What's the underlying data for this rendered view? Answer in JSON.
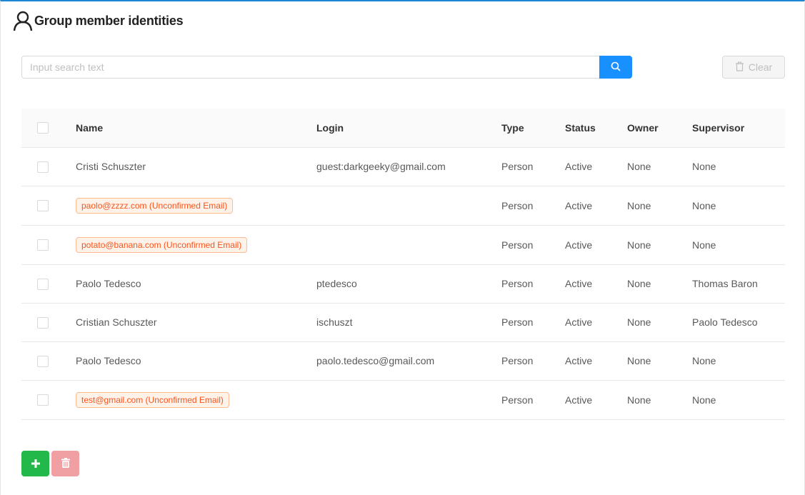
{
  "header": {
    "title": "Group member identities",
    "icon": "user-icon"
  },
  "search": {
    "placeholder": "Input search text",
    "value": "",
    "button_icon": "search-icon"
  },
  "toolbar": {
    "clear_label": "Clear",
    "clear_icon": "trash-icon"
  },
  "table": {
    "columns": [
      "Name",
      "Login",
      "Type",
      "Status",
      "Owner",
      "Supervisor"
    ],
    "rows": [
      {
        "name": "Cristi Schuszter",
        "unconfirmed": false,
        "login": "guest:darkgeeky@gmail.com",
        "type": "Person",
        "status": "Active",
        "owner": "None",
        "supervisor": "None"
      },
      {
        "name": "paolo@zzzz.com (Unconfirmed Email)",
        "unconfirmed": true,
        "login": "",
        "type": "Person",
        "status": "Active",
        "owner": "None",
        "supervisor": "None"
      },
      {
        "name": "potato@banana.com (Unconfirmed Email)",
        "unconfirmed": true,
        "login": "",
        "type": "Person",
        "status": "Active",
        "owner": "None",
        "supervisor": "None"
      },
      {
        "name": "Paolo Tedesco",
        "unconfirmed": false,
        "login": "ptedesco",
        "type": "Person",
        "status": "Active",
        "owner": "None",
        "supervisor": "Thomas Baron"
      },
      {
        "name": "Cristian Schuszter",
        "unconfirmed": false,
        "login": "ischuszt",
        "type": "Person",
        "status": "Active",
        "owner": "None",
        "supervisor": "Paolo Tedesco"
      },
      {
        "name": "Paolo Tedesco",
        "unconfirmed": false,
        "login": "paolo.tedesco@gmail.com",
        "type": "Person",
        "status": "Active",
        "owner": "None",
        "supervisor": "None"
      },
      {
        "name": "test@gmail.com (Unconfirmed Email)",
        "unconfirmed": true,
        "login": "",
        "type": "Person",
        "status": "Active",
        "owner": "None",
        "supervisor": "None"
      }
    ]
  },
  "actions": {
    "add_icon": "plus-icon",
    "delete_icon": "trash-icon"
  },
  "colors": {
    "accent": "#1890ff",
    "top_border": "#1f86d6",
    "add": "#22b94a",
    "delete_disabled": "#f0a0a3",
    "tag_text": "#fa541c"
  }
}
